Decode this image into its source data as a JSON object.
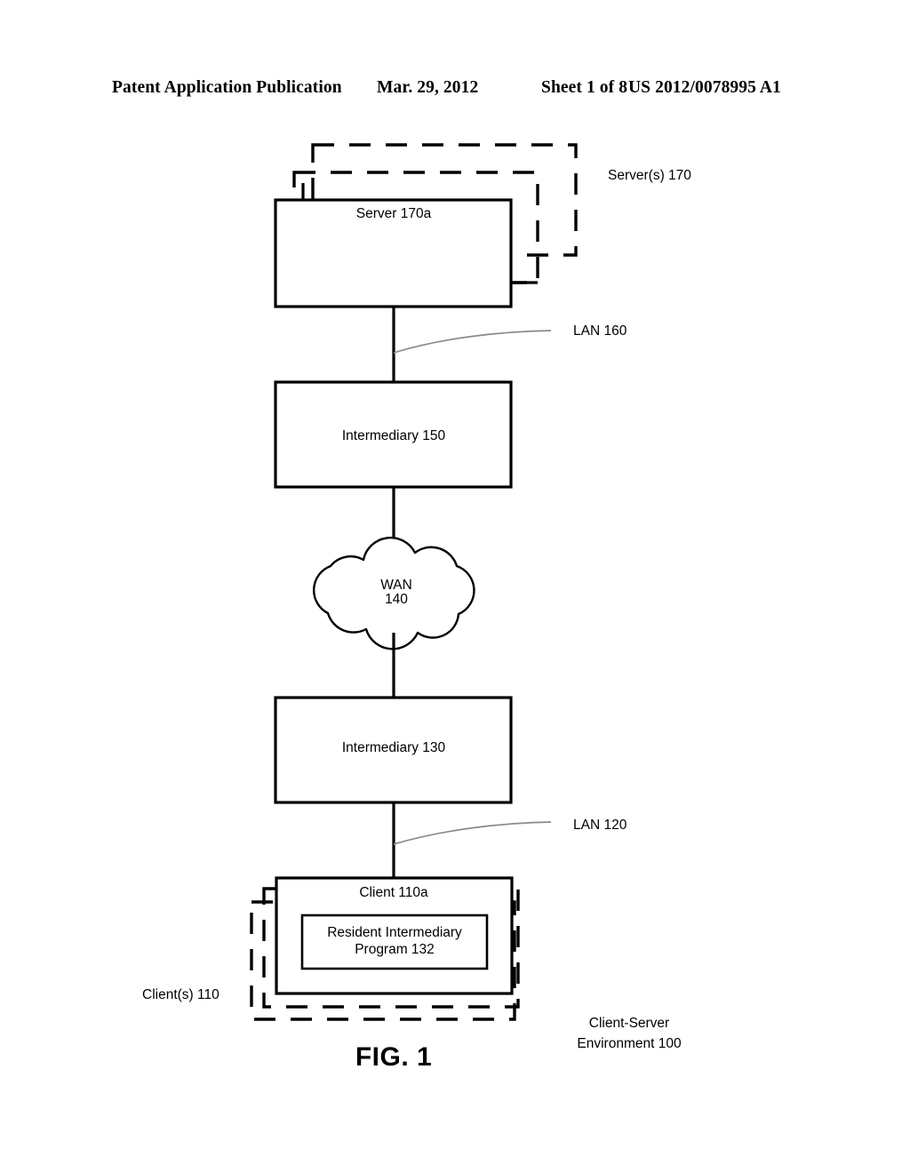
{
  "header": {
    "publication": "Patent Application Publication",
    "date": "Mar. 29, 2012",
    "sheet": "Sheet 1 of 8",
    "number": "US 2012/0078995 A1"
  },
  "figure": {
    "caption": "FIG. 1",
    "environment_label_line1": "Client-Server",
    "environment_label_line2": "Environment 100",
    "nodes": {
      "server_box": "Server 170a",
      "servers_group": "Server(s) 170",
      "lan_upper": "LAN 160",
      "intermediary_upper": "Intermediary 150",
      "wan_line1": "WAN",
      "wan_line2": "140",
      "intermediary_lower": "Intermediary 130",
      "lan_lower": "LAN 120",
      "client_box": "Client 110a",
      "clients_group": "Client(s) 110",
      "resident_program_line1": "Resident Intermediary",
      "resident_program_line2": "Program 132"
    },
    "colors": {
      "ink": "#000000",
      "leader": "#8a8a8a",
      "background": "#ffffff"
    }
  }
}
